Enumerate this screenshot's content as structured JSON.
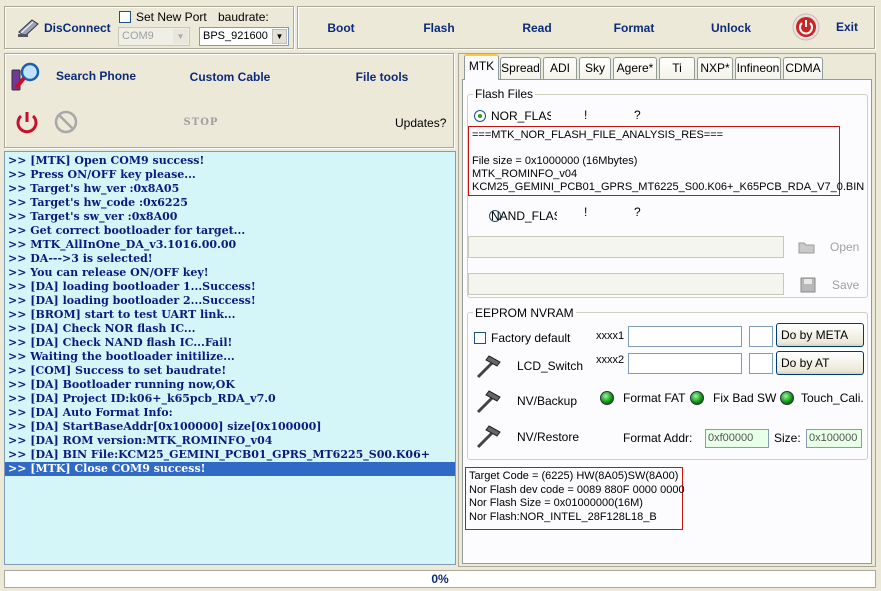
{
  "toolbar": {
    "disconnect_label": "DisConnect",
    "set_new_port_label": "Set New Port",
    "port_value": "COM9",
    "baudrate_label": "baudrate:",
    "baudrate_value": "BPS_921600",
    "boot_label": "Boot",
    "flash_label": "Flash",
    "read_label": "Read",
    "format_label": "Format",
    "unlock_label": "Unlock",
    "exit_label": "Exit"
  },
  "actions": {
    "search_phone_label": "Search Phone",
    "custom_cable_label": "Custom Cable",
    "file_tools_label": "File tools",
    "stop_label": "STOP",
    "updates_label": "Updates?"
  },
  "log": {
    "lines": [
      ">> [MTK] Open COM9 success!",
      ">> Press ON/OFF key please...",
      ">> Target's hw_ver :0x8A05",
      ">> Target's hw_code :0x6225",
      ">> Target's sw_ver :0x8A00",
      ">> Get correct bootloader for target...",
      ">> MTK_AllInOne_DA_v3.1016.00.00",
      ">> DA--->3 is selected!",
      ">> You can release ON/OFF key!",
      ">> [DA] loading bootloader 1...Success!",
      ">> [DA] loading bootloader 2...Success!",
      ">> [BROM] start to test UART link...",
      ">> [DA] Check NOR flash IC...",
      ">> [DA] Check NAND flash IC...Fail!",
      ">> Waiting the bootloader initilize...",
      ">> [COM] Success to set baudrate!",
      ">> [DA] Bootloader running now,OK",
      ">> [DA] Project ID:k06+_k65pcb_RDA_v7.0",
      ">> [DA] Auto Format Info:",
      ">> [DA] StartBaseAddr[0x100000] size[0x100000]",
      ">> [DA] ROM version:MTK_ROMINFO_v04",
      ">> [DA] BIN File:KCM25_GEMINI_PCB01_GPRS_MT6225_S00.K06+",
      ">> [MTK] Close COM9 success!"
    ],
    "selected_index": 22
  },
  "tabs": [
    "MTK",
    "Spread",
    "ADI",
    "Sky",
    "Agere*",
    "Ti",
    "NXP*",
    "Infineon",
    "CDMA"
  ],
  "active_tab": "MTK",
  "flash_files": {
    "group_label": "Flash Files",
    "nor_label": "NOR_FLASH",
    "nor_mark1": "!",
    "nor_mark2": "?",
    "nor_info": [
      "===MTK_NOR_FLASH_FILE_ANALYSIS_RES===",
      "",
      "File size = 0x1000000 (16Mbytes)",
      "MTK_ROMINFO_v04",
      "KCM25_GEMINI_PCB01_GPRS_MT6225_S00.K06+_K65PCB_RDA_V7_0.BIN"
    ],
    "nand_label": "NAND_FLASH",
    "nand_mark1": "!",
    "nand_mark2": "?",
    "open_label": "Open",
    "save_label": "Save"
  },
  "eeprom": {
    "group_label": "EEPROM NVRAM",
    "factory_default_label": "Factory default",
    "xxxx1_label": "xxxx1",
    "xxxx2_label": "xxxx2",
    "do_by_meta_label": "Do by META",
    "do_by_at_label": "Do by AT",
    "lcd_switch_label": "LCD_Switch",
    "nv_backup_label": "NV/Backup",
    "nv_restore_label": "NV/Restore",
    "format_fat_label": "Format FAT",
    "fix_bad_sw_label": "Fix Bad SW",
    "touch_cali_label": "Touch_Cali...",
    "format_addr_label": "Format Addr:",
    "format_addr_value": "0xf00000",
    "size_label": "Size:",
    "size_value": "0x100000"
  },
  "target_info": [
    "Target Code = (6225) HW(8A05)SW(8A00)",
    "Nor Flash dev code = 0089 880F 0000 0000",
    "Nor Flash Size = 0x01000000(16M)",
    "Nor Flash:NOR_INTEL_28F128L18_B"
  ],
  "progress": {
    "percent_label": "0%",
    "value": 0
  },
  "colors": {
    "log_bg": "#d4f6f9",
    "log_text": "#0a1a80",
    "selection": "#316ac5",
    "info_border": "#cc1111"
  }
}
